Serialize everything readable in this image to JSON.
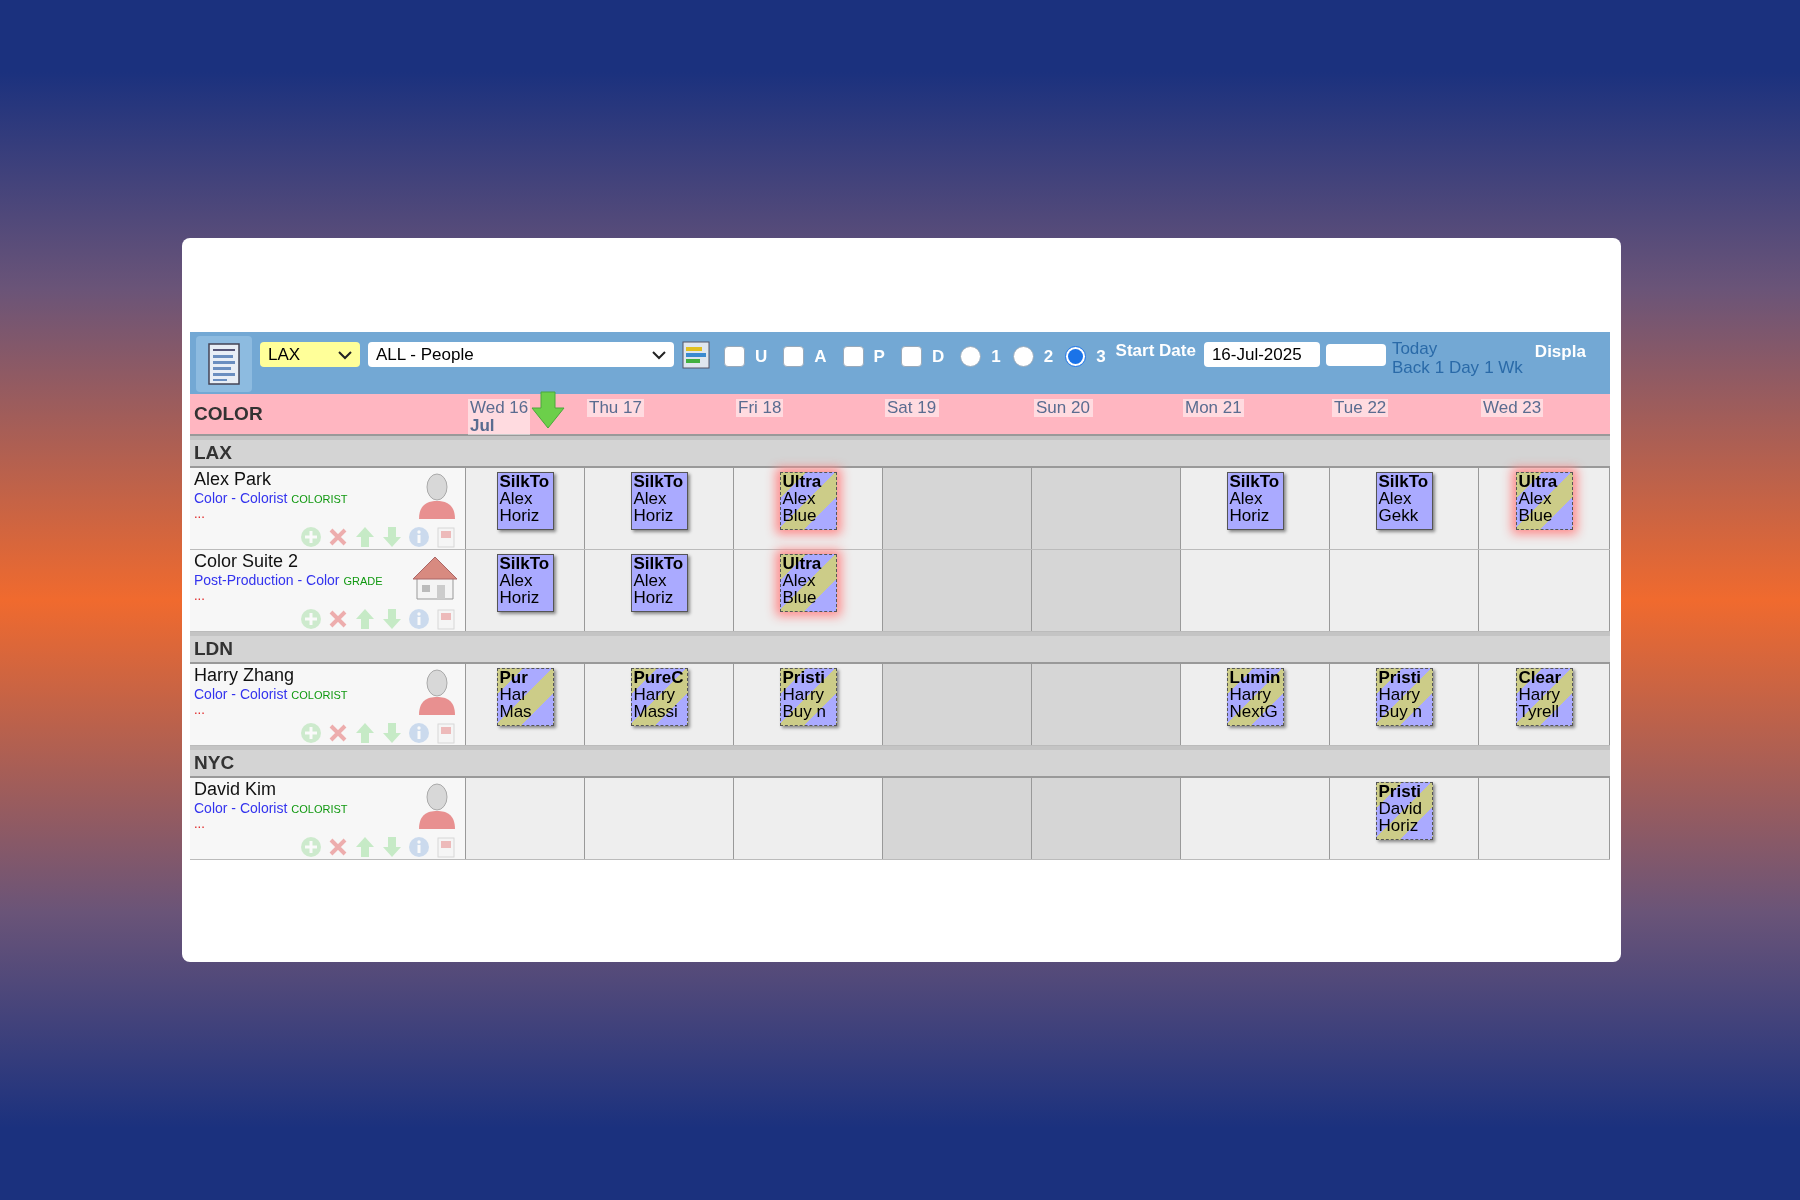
{
  "toolbar": {
    "location_select": "LAX",
    "people_select": "ALL - People",
    "filters": [
      {
        "label": "U",
        "checked": false
      },
      {
        "label": "A",
        "checked": false
      },
      {
        "label": "P",
        "checked": false
      },
      {
        "label": "D",
        "checked": false
      }
    ],
    "views": [
      {
        "label": "1",
        "selected": false
      },
      {
        "label": "2",
        "selected": false
      },
      {
        "label": "3",
        "selected": true
      }
    ],
    "start_date_label": "Start Date",
    "start_date": "16-Jul-2025",
    "today_link": "Today",
    "nav_links": [
      "Back",
      "1 Day",
      "1 Wk"
    ],
    "display_label": "Displa"
  },
  "department": "COLOR",
  "days": [
    {
      "label": "Wed 16",
      "month": "Jul",
      "today": true,
      "weekend": false
    },
    {
      "label": "Thu 17",
      "today": false,
      "weekend": false
    },
    {
      "label": "Fri 18",
      "today": false,
      "weekend": false
    },
    {
      "label": "Sat 19",
      "today": false,
      "weekend": true
    },
    {
      "label": "Sun 20",
      "today": false,
      "weekend": true
    },
    {
      "label": "Mon 21",
      "today": false,
      "weekend": false
    },
    {
      "label": "Tue 22",
      "today": false,
      "weekend": false
    },
    {
      "label": "Wed 23",
      "today": false,
      "weekend": false
    }
  ],
  "groups": [
    {
      "name": "LAX",
      "resources": [
        {
          "name": "Alex Park",
          "kind": "person",
          "department": "Color - Colorist",
          "role": "COLORIST",
          "more": "...",
          "cells": [
            {
              "booking": {
                "kind": "solid",
                "conflict": false,
                "lines": [
                  "SilkTo",
                  "Alex",
                  "Horiz"
                ]
              }
            },
            {
              "booking": {
                "kind": "solid",
                "conflict": false,
                "lines": [
                  "SilkTo",
                  "Alex",
                  "Horiz"
                ]
              }
            },
            {
              "booking": {
                "kind": "striped",
                "conflict": true,
                "lines": [
                  "Ultra",
                  "Alex",
                  "Blue"
                ]
              }
            },
            {},
            {},
            {
              "booking": {
                "kind": "solid",
                "conflict": false,
                "lines": [
                  "SilkTo",
                  "Alex",
                  "Horiz"
                ]
              }
            },
            {
              "booking": {
                "kind": "solid",
                "conflict": false,
                "lines": [
                  "SilkTo",
                  "Alex",
                  "Gekk"
                ]
              }
            },
            {
              "booking": {
                "kind": "striped",
                "conflict": true,
                "lines": [
                  "Ultra",
                  "Alex",
                  "Blue"
                ]
              }
            }
          ]
        },
        {
          "name": "Color Suite 2",
          "kind": "room",
          "department": "Post-Production - Color",
          "role": "GRADE",
          "more": "...",
          "cells": [
            {
              "booking": {
                "kind": "solid",
                "conflict": false,
                "lines": [
                  "SilkTo",
                  "Alex",
                  "Horiz"
                ]
              }
            },
            {
              "booking": {
                "kind": "solid",
                "conflict": false,
                "lines": [
                  "SilkTo",
                  "Alex",
                  "Horiz"
                ]
              }
            },
            {
              "booking": {
                "kind": "striped",
                "conflict": true,
                "lines": [
                  "Ultra",
                  "Alex",
                  "Blue"
                ]
              }
            },
            {},
            {},
            {},
            {},
            {}
          ]
        }
      ]
    },
    {
      "name": "LDN",
      "resources": [
        {
          "name": "Harry Zhang",
          "kind": "person",
          "department": "Color - Colorist",
          "role": "COLORIST",
          "more": "...",
          "cells": [
            {
              "booking": {
                "kind": "striped",
                "conflict": false,
                "lines": [
                  "Pur",
                  "Har",
                  "Mas"
                ]
              }
            },
            {
              "booking": {
                "kind": "striped",
                "conflict": false,
                "lines": [
                  "PureC",
                  "Harry",
                  "Massi"
                ]
              }
            },
            {
              "booking": {
                "kind": "striped",
                "conflict": false,
                "lines": [
                  "Pristi",
                  "Harry",
                  "Buy n"
                ]
              }
            },
            {},
            {},
            {
              "booking": {
                "kind": "striped",
                "conflict": false,
                "lines": [
                  "Lumin",
                  "Harry",
                  "NextG"
                ]
              }
            },
            {
              "booking": {
                "kind": "striped",
                "conflict": false,
                "lines": [
                  "Pristi",
                  "Harry",
                  "Buy n"
                ]
              }
            },
            {
              "booking": {
                "kind": "striped",
                "conflict": false,
                "lines": [
                  "Clear",
                  "Harry",
                  "Tyrell"
                ]
              }
            }
          ]
        }
      ]
    },
    {
      "name": "NYC",
      "resources": [
        {
          "name": "David Kim",
          "kind": "person",
          "department": "Color - Colorist",
          "role": "COLORIST",
          "more": "...",
          "cells": [
            {},
            {},
            {},
            {},
            {},
            {},
            {
              "booking": {
                "kind": "striped",
                "conflict": false,
                "lines": [
                  "Pristi",
                  "David",
                  "Horiz"
                ]
              }
            },
            {}
          ]
        }
      ]
    }
  ]
}
